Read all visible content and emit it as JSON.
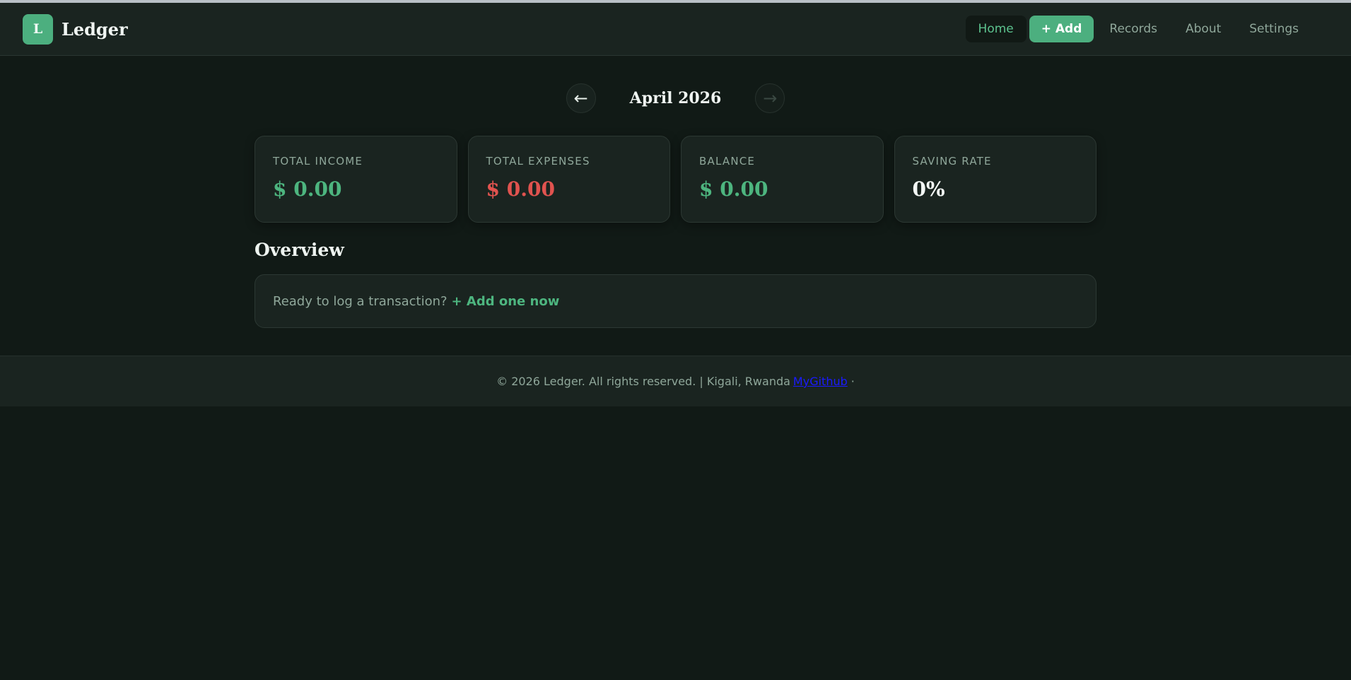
{
  "app": {
    "logo_letter": "L",
    "name": "Ledger"
  },
  "nav": {
    "items": [
      {
        "label": "Home"
      },
      {
        "label": "+ Add"
      },
      {
        "label": "Records"
      },
      {
        "label": "About"
      },
      {
        "label": "Settings"
      }
    ],
    "active": "Home"
  },
  "month_nav": {
    "prev": "←",
    "label": "April 2026",
    "next": "→"
  },
  "stats": [
    {
      "label": "TOTAL INCOME",
      "value": "$ 0.00"
    },
    {
      "label": "TOTAL EXPENSES",
      "value": "$ 0.00"
    },
    {
      "label": "BALANCE",
      "value": "$ 0.00"
    },
    {
      "label": "SAVING RATE",
      "value": "0%"
    }
  ],
  "overview": {
    "title": "Overview",
    "prompt": "Ready to log a transaction?",
    "link": "+ Add one now"
  },
  "footer": {
    "text": "© 2026 Ledger. All rights reserved. | Kigali, Rwanda",
    "link": "MyGithub",
    "trailing": "·"
  },
  "colors": {
    "accent": "#4caf7f",
    "income": "#4db57f",
    "expense": "#e0534f",
    "background": "#111a16",
    "surface": "#1a2420"
  }
}
